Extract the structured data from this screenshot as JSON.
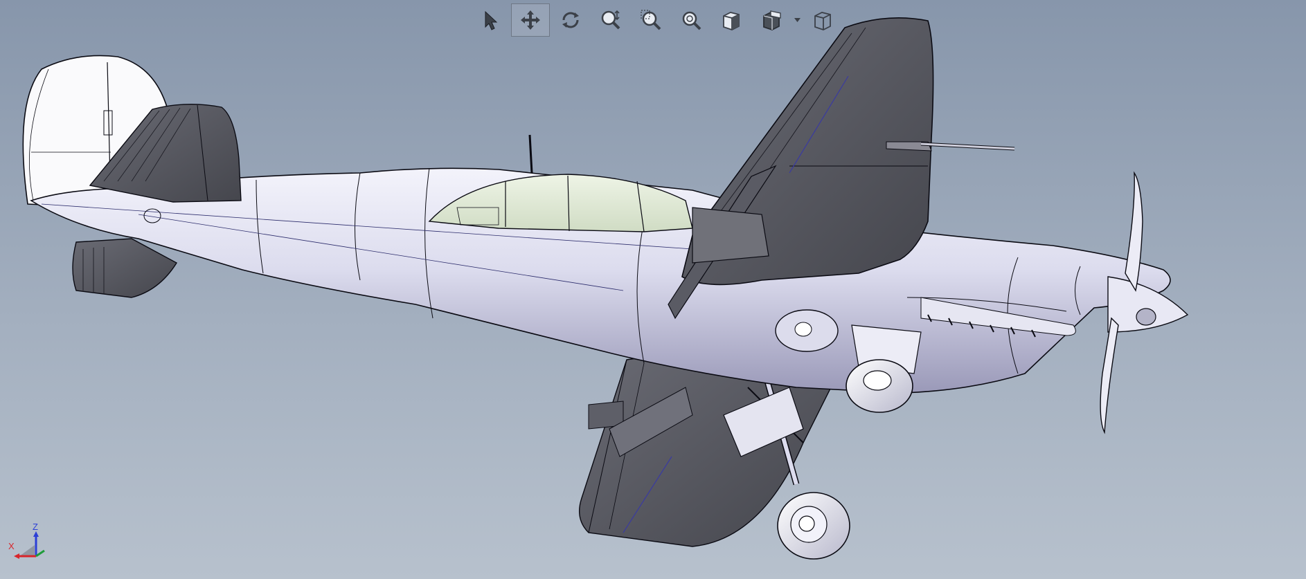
{
  "app": {
    "name": "3D CAD viewport"
  },
  "toolbar": {
    "tools": [
      {
        "name": "select-tool",
        "icon": "arrow-pointer-icon",
        "active": false
      },
      {
        "name": "pan-tool",
        "icon": "move-arrows-icon",
        "active": true
      },
      {
        "name": "rotate-tool",
        "icon": "rotate-icon",
        "active": false
      },
      {
        "name": "zoom-in-out-tool",
        "icon": "zoom-in-out-icon",
        "active": false
      },
      {
        "name": "zoom-to-area-tool",
        "icon": "zoom-area-icon",
        "active": false
      },
      {
        "name": "zoom-to-fit-tool",
        "icon": "zoom-fit-icon",
        "active": false
      },
      {
        "name": "standard-views-tool",
        "icon": "cube-icon",
        "active": false
      },
      {
        "name": "section-view-tool",
        "icon": "section-cube-icon",
        "active": false,
        "has_dropdown": true
      },
      {
        "name": "display-style-tool",
        "icon": "wireframe-cube-icon",
        "active": false
      }
    ]
  },
  "triad": {
    "x_label": "X",
    "z_label": "Z"
  },
  "colors": {
    "bg_top": "#8796ab",
    "bg_bottom": "#b7c1cd",
    "fuselage": "#d4d6ea",
    "dark_surface": "#56575f",
    "line": "#0a0a12",
    "axis_x": "#d8252b",
    "axis_y": "#1f9c3a",
    "axis_z": "#2c3fd6"
  }
}
